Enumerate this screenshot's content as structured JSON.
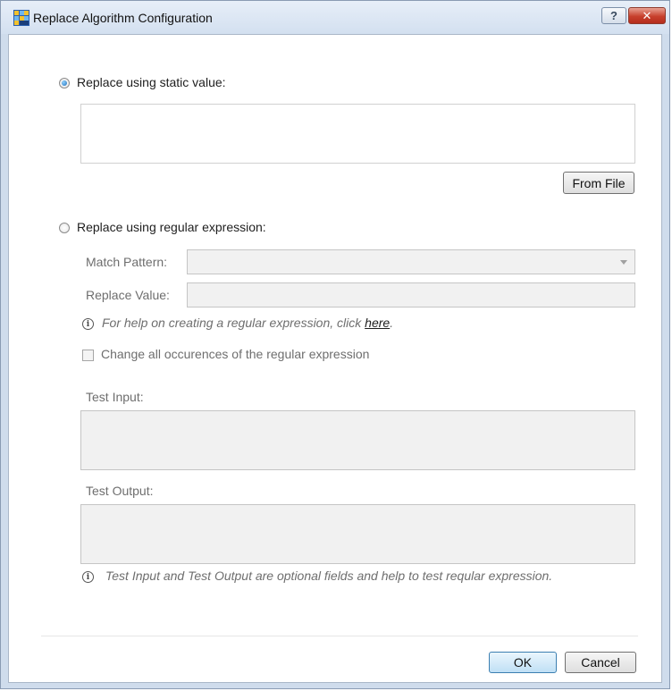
{
  "window": {
    "title": "Replace Algorithm Configuration",
    "help_label": "?",
    "close_label": "✕"
  },
  "static_option": {
    "label": "Replace using static value:",
    "selected": true,
    "value": "",
    "from_file_label": "From File"
  },
  "regex_option": {
    "label": "Replace using regular expression:",
    "selected": false,
    "match_pattern_label": "Match Pattern:",
    "match_pattern_value": "",
    "replace_value_label": "Replace Value:",
    "replace_value_value": "",
    "help_text": "For help on creating a regular expression, click ",
    "help_link": "here",
    "help_suffix": ".",
    "change_all_label": "Change all occurences of the regular expression",
    "change_all_checked": false,
    "test_input_label": "Test Input:",
    "test_output_label": "Test Output:",
    "test_note": "Test Input and Test Output are optional fields and help to test reqular expression."
  },
  "footer": {
    "ok_label": "OK",
    "cancel_label": "Cancel"
  }
}
